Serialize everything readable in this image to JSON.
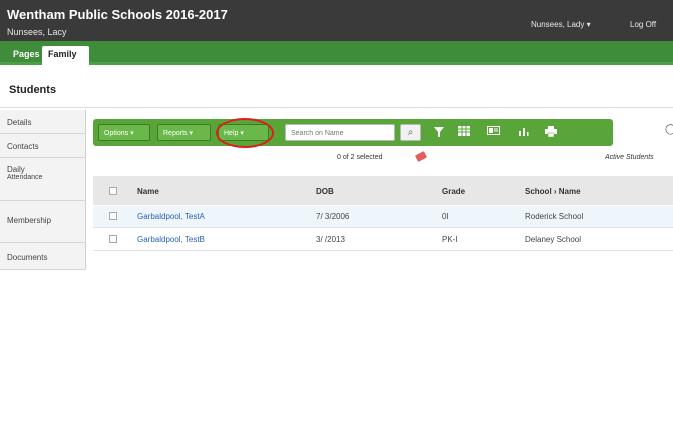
{
  "header": {
    "school": "Wentham Public Schools 2016-2017",
    "user": "Nunsees, Lacy",
    "user_menu": "Nunsees, Lady ▾",
    "logoff": "Log Off"
  },
  "tabs": [
    "Pages",
    "Family"
  ],
  "page_title": "Students",
  "sidebar": {
    "items": [
      {
        "label": "Details",
        "sub": ""
      },
      {
        "label": "Contacts",
        "sub": ""
      },
      {
        "label": "Daily",
        "sub": "Attendance"
      },
      {
        "label": "Membership",
        "sub": ""
      },
      {
        "label": "Documents",
        "sub": ""
      }
    ]
  },
  "toolbar": {
    "options_label": "Options ▾",
    "reports_label": "Reports ▾",
    "help_label": "Help ▾",
    "search_placeholder": "Search on Name",
    "search_icon": "magnifier-icon",
    "filter_icon": "filter-icon",
    "grid_icon": "grid-icon",
    "card_icon": "card-icon",
    "chart_icon": "bar-chart-icon",
    "print_icon": "print-icon"
  },
  "status": {
    "selected_count": "0 of 2 selected",
    "filter_label": "Active Students"
  },
  "table": {
    "headers": [
      "Name",
      "DOB",
      "Grade",
      "School › Name"
    ],
    "rows": [
      [
        "Garbaldpool, TestA",
        "7/ 3/2006",
        "0I",
        "Roderick School"
      ],
      [
        "Garbaldpool, TestB",
        "3/ /2013",
        "PK-I",
        "Delaney School"
      ]
    ]
  },
  "colors": {
    "header_bg": "#3a3a3a",
    "tab_green": "#3f8d3a",
    "toolbar_green": "#5aa53a",
    "highlight_circle": "#e01c1c",
    "link_blue": "#2b61b8"
  }
}
